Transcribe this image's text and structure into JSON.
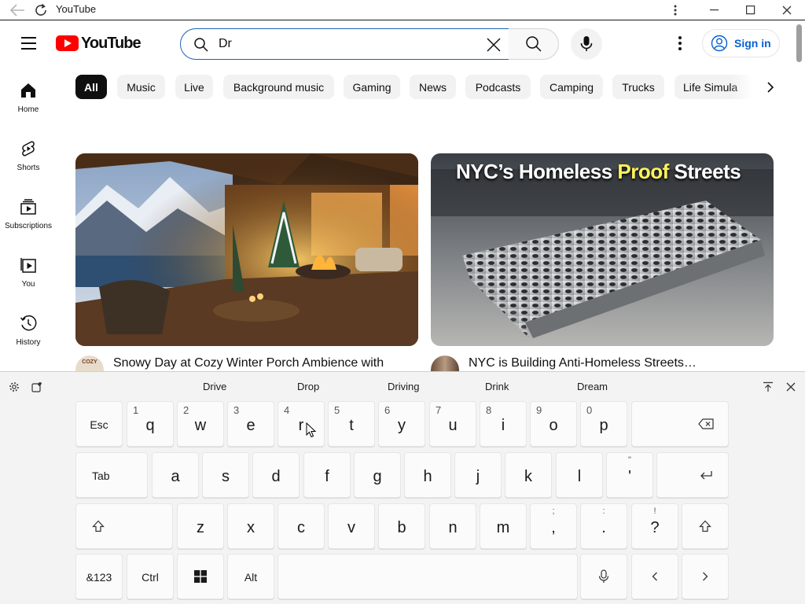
{
  "window": {
    "title": "YouTube"
  },
  "header": {
    "logo_text": "YouTube",
    "search_value": "Dr",
    "sign_in_label": "Sign in"
  },
  "sidebar": {
    "items": [
      {
        "label": "Home",
        "icon": "home-icon"
      },
      {
        "label": "Shorts",
        "icon": "shorts-icon"
      },
      {
        "label": "Subscriptions",
        "icon": "subscriptions-icon"
      },
      {
        "label": "You",
        "icon": "you-icon"
      },
      {
        "label": "History",
        "icon": "history-icon"
      }
    ]
  },
  "chips": [
    "All",
    "Music",
    "Live",
    "Background music",
    "Gaming",
    "News",
    "Podcasts",
    "Camping",
    "Trucks",
    "Life Simula"
  ],
  "videos": [
    {
      "title": "Snowy Day at Cozy Winter Porch Ambience with",
      "avatar_text": "COZY"
    },
    {
      "title": "NYC is Building Anti-Homeless Streets…",
      "thumb_text_white": "NYC’s Homeless ",
      "thumb_text_yellow": "Proof",
      "thumb_text_white2": " Streets"
    }
  ],
  "keyboard": {
    "suggestions": [
      "Drive",
      "Drop",
      "Driving",
      "Drink",
      "Dream"
    ],
    "row1": [
      {
        "main": "q",
        "num": "1"
      },
      {
        "main": "w",
        "num": "2"
      },
      {
        "main": "e",
        "num": "3"
      },
      {
        "main": "r",
        "num": "4"
      },
      {
        "main": "t",
        "num": "5"
      },
      {
        "main": "y",
        "num": "6"
      },
      {
        "main": "u",
        "num": "7"
      },
      {
        "main": "i",
        "num": "8"
      },
      {
        "main": "o",
        "num": "9"
      },
      {
        "main": "p",
        "num": "0"
      }
    ],
    "row2": [
      "a",
      "s",
      "d",
      "f",
      "g",
      "h",
      "j",
      "k",
      "l"
    ],
    "row2_punct": {
      "main": "'",
      "sub": "\""
    },
    "row3": [
      "z",
      "x",
      "c",
      "v",
      "b",
      "n",
      "m"
    ],
    "row3_punct": [
      {
        "main": ",",
        "sub": ";"
      },
      {
        "main": ".",
        "sub": ":"
      },
      {
        "main": "?",
        "sub": "!"
      }
    ],
    "esc_label": "Esc",
    "tab_label": "Tab",
    "sym_label": "&123",
    "ctrl_label": "Ctrl",
    "alt_label": "Alt"
  },
  "colors": {
    "brand": "#ff0000",
    "link": "#065fd4",
    "search_focus": "#1c62b9"
  }
}
